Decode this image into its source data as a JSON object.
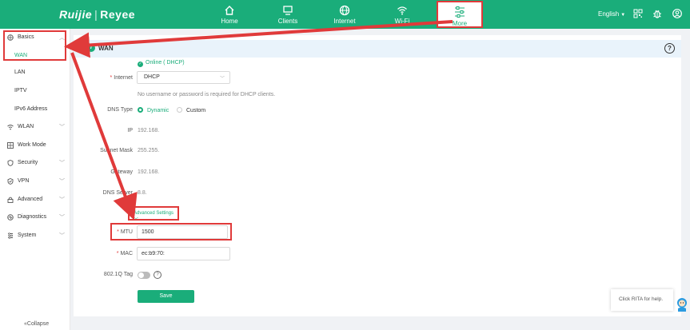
{
  "header": {
    "brand": "Ruijie",
    "brand_sub": "Reyee",
    "nav": [
      {
        "label": "Home",
        "icon": "home-icon"
      },
      {
        "label": "Clients",
        "icon": "clients-icon"
      },
      {
        "label": "Internet",
        "icon": "globe-icon"
      },
      {
        "label": "Wi-Fi",
        "icon": "wifi-icon"
      },
      {
        "label": "More",
        "icon": "more-icon"
      }
    ],
    "language": "English",
    "accent": "#1aad7a",
    "highlight": "#e03a3a"
  },
  "sidebar": {
    "items": [
      {
        "label": "Basics",
        "icon": "globe-icon"
      },
      {
        "label": "WLAN",
        "icon": "wifi-icon"
      },
      {
        "label": "Work Mode",
        "icon": "mode-icon"
      },
      {
        "label": "Security",
        "icon": "shield-icon"
      },
      {
        "label": "VPN",
        "icon": "vpn-icon"
      },
      {
        "label": "Advanced",
        "icon": "lock-icon"
      },
      {
        "label": "Diagnostics",
        "icon": "diagnostics-icon"
      },
      {
        "label": "System",
        "icon": "system-icon"
      }
    ],
    "basics_sub": [
      "WAN",
      "LAN",
      "IPTV",
      "IPv6 Address"
    ],
    "collapse": "Collapse"
  },
  "wan": {
    "title": "WAN",
    "status": "Online ( DHCP)",
    "internet_label": "Internet",
    "internet_value": "DHCP",
    "hint": "No username or password is required for DHCP clients.",
    "dns_type_label": "DNS Type",
    "dns_dynamic": "Dynamic",
    "dns_custom": "Custom",
    "ip_label": "IP",
    "ip_value": "192.168.",
    "mask_label": "Subnet Mask",
    "mask_value": "255.255.",
    "gateway_label": "Gateway",
    "gateway_value": "192.168.",
    "dns_server_label": "DNS Server",
    "dns_server_value": "8.8.",
    "advanced_settings": "Advanced Settings",
    "mtu_label": "MTU",
    "mtu_value": "1500",
    "mac_label": "MAC",
    "mac_value": "ec:b9:70:",
    "vlan_label": "802.1Q Tag",
    "save": "Save"
  },
  "rita": {
    "text": "Click RITA for help."
  }
}
